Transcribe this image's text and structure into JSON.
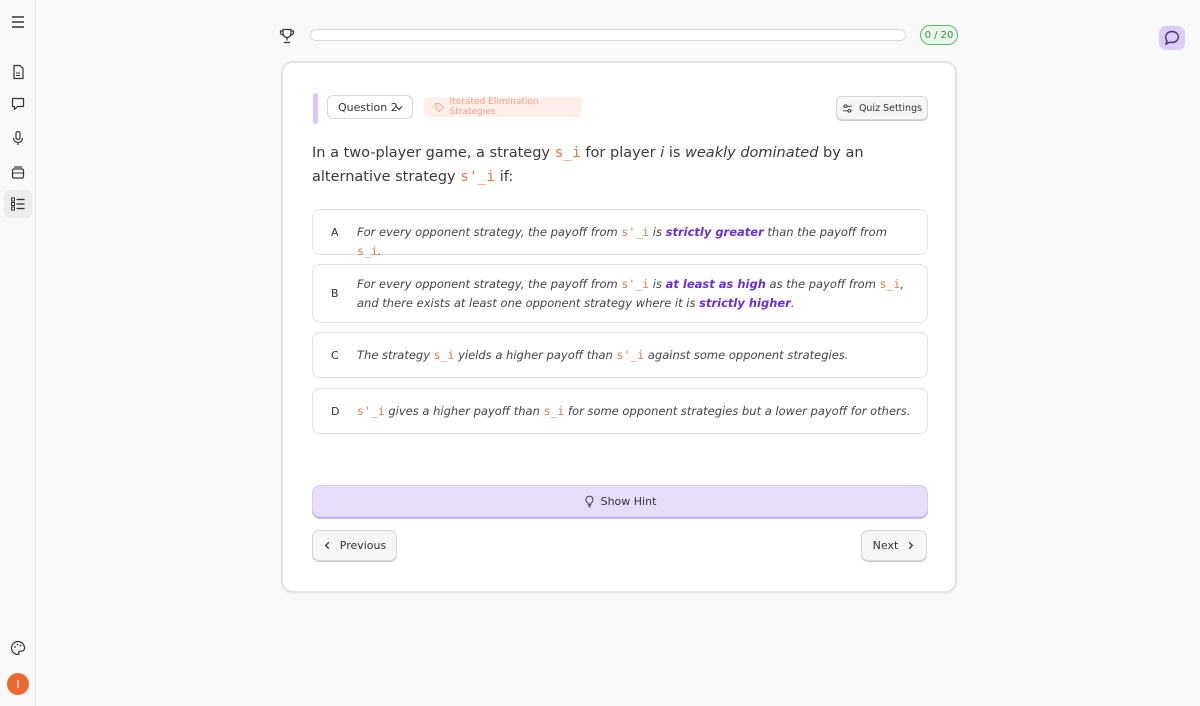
{
  "sidebar": {
    "items": [
      {
        "icon": "menu-icon"
      },
      {
        "icon": "document-icon"
      },
      {
        "icon": "chat-icon"
      },
      {
        "icon": "microphone-icon"
      },
      {
        "icon": "cards-icon"
      },
      {
        "icon": "list-icon",
        "active": true
      },
      {
        "icon": "palette-icon"
      }
    ],
    "avatar_initial": "I",
    "avatar_color": "#ec6a2f"
  },
  "progress": {
    "count_label": "0 / 20",
    "fraction": 0
  },
  "quiz": {
    "question_selector": "Question 2",
    "topic_tag": "Iterated Elimination Strategies",
    "settings_label": "Quiz Settings",
    "question": {
      "p1": "In a two-player game, a strategy ",
      "c1": "s_i",
      "p2": " for player ",
      "i": "i",
      "p3": " is ",
      "em": "weakly dominated",
      "p4": " by an alternative strategy ",
      "c2": "s'_i",
      "p5": " if:"
    },
    "options": [
      {
        "letter": "A",
        "t1": "For every opponent strategy, the payoff from ",
        "c1": "s'_i",
        "t2": " is ",
        "h1": "strictly greater",
        "t3": " than the payoff from ",
        "c2": "s_i",
        "t4": "."
      },
      {
        "letter": "B",
        "t1": "For every opponent strategy, the payoff from ",
        "c1": "s'_i",
        "t2": " is ",
        "h1": "at least as high",
        "t3": " as the payoff from ",
        "c2": "s_i",
        "t4": ", and there exists at least one opponent strategy where it is ",
        "h2": "strictly higher",
        "t5": "."
      },
      {
        "letter": "C",
        "t1": "The strategy ",
        "c1": "s_i",
        "t2": " yields a higher payoff than ",
        "c2": "s'_i",
        "t3": " against some opponent strategies."
      },
      {
        "letter": "D",
        "c1": "s'_i",
        "t1": " gives a higher payoff than ",
        "c2": "s_i",
        "t2": " for some opponent strategies but a lower payoff for others."
      }
    ],
    "hint_label": "Show Hint",
    "previous_label": "Previous",
    "next_label": "Next"
  },
  "colors": {
    "accent_purple": "#6a2fd6",
    "code_orange": "#e8793f",
    "hint_bg": "#e7ddfb",
    "progress_green": "#5cb86a"
  }
}
